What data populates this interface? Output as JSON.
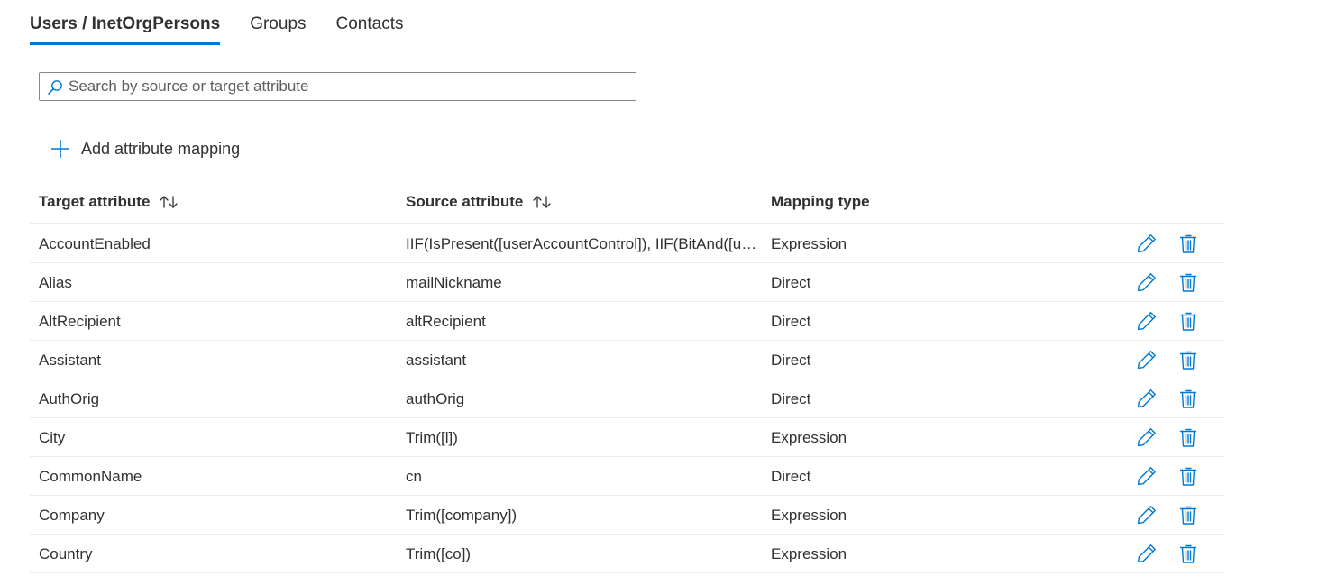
{
  "tabs": [
    {
      "label": "Users / InetOrgPersons",
      "active": true
    },
    {
      "label": "Groups",
      "active": false
    },
    {
      "label": "Contacts",
      "active": false
    }
  ],
  "search": {
    "placeholder": "Search by source or target attribute",
    "value": "",
    "icon": "search-icon"
  },
  "add_button": {
    "label": "Add attribute mapping",
    "icon": "plus-icon"
  },
  "table": {
    "columns": [
      {
        "label": "Target attribute",
        "sortable": true
      },
      {
        "label": "Source attribute",
        "sortable": true
      },
      {
        "label": "Mapping type",
        "sortable": false
      }
    ],
    "rows": [
      {
        "target": "AccountEnabled",
        "source": "IIF(IsPresent([userAccountControl]), IIF(BitAnd([us...",
        "type": "Expression"
      },
      {
        "target": "Alias",
        "source": "mailNickname",
        "type": "Direct"
      },
      {
        "target": "AltRecipient",
        "source": "altRecipient",
        "type": "Direct"
      },
      {
        "target": "Assistant",
        "source": "assistant",
        "type": "Direct"
      },
      {
        "target": "AuthOrig",
        "source": "authOrig",
        "type": "Direct"
      },
      {
        "target": "City",
        "source": "Trim([l])",
        "type": "Expression"
      },
      {
        "target": "CommonName",
        "source": "cn",
        "type": "Direct"
      },
      {
        "target": "Company",
        "source": "Trim([company])",
        "type": "Expression"
      },
      {
        "target": "Country",
        "source": "Trim([co])",
        "type": "Expression"
      }
    ],
    "row_actions": {
      "edit_icon": "pencil-icon",
      "delete_icon": "trash-icon"
    }
  },
  "colors": {
    "accent": "#0078d4",
    "text": "#323130",
    "divider": "#edebe9",
    "input_border": "#8a8886"
  }
}
